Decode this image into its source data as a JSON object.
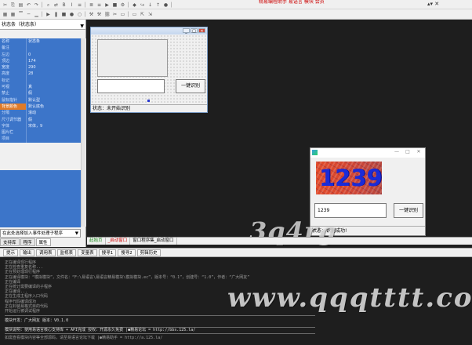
{
  "toolbar": {
    "top_icons": [
      "cut",
      "copy",
      "paste",
      "undo",
      "redo",
      "find",
      "replace",
      "bold",
      "italic",
      "align-left",
      "align-center",
      "align-right",
      "run",
      "stop",
      "compile",
      "debug",
      "step-over",
      "step-into",
      "step-out",
      "breakpoint"
    ],
    "row2_icons": [
      "grid",
      "grid-2",
      "align-top",
      "align-mid",
      "align-bottom",
      "play",
      "pause",
      "stop",
      "rec",
      "rec-2",
      "build",
      "build-2",
      "link",
      "unlink",
      "monitor",
      "monitor-2",
      "ext",
      "ext-2"
    ],
    "red_text": "精易编程助手  易语言  模块  会员",
    "ctrl_buttons": "▴▾ ✕"
  },
  "left_panel": {
    "object_selector": "状态条（状态条）",
    "properties": [
      {
        "key": "名称",
        "value": "状态条"
      },
      {
        "key": "备注",
        "value": ""
      },
      {
        "key": "左边",
        "value": "0"
      },
      {
        "key": "顶边",
        "value": "174"
      },
      {
        "key": "宽度",
        "value": "290"
      },
      {
        "key": "高度",
        "value": "28"
      },
      {
        "key": "标记",
        "value": ""
      },
      {
        "key": "可视",
        "value": "真"
      },
      {
        "key": "禁止",
        "value": "假"
      },
      {
        "key": "鼠标指针",
        "value": "默认型"
      },
      {
        "key": "背景颜色",
        "value": "默认底色",
        "highlight": true
      },
      {
        "key": "分隔",
        "value": "滚动"
      },
      {
        "key": "尺寸调节器",
        "value": "假"
      },
      {
        "key": "字体",
        "value": "宋体，9"
      },
      {
        "key": "图片栏",
        "value": ""
      },
      {
        "key": "项目",
        "value": ""
      }
    ],
    "event_selector": "在此处选择加入事件处理子程序",
    "tabs": [
      "支持库",
      "程序",
      "属性"
    ]
  },
  "design_window": {
    "min": "_",
    "max": "□",
    "close": "✕",
    "button_label": "一键识别",
    "status_text": "状态：未开始识别"
  },
  "run_window": {
    "min": "—",
    "max": "□",
    "close": "✕",
    "captcha_text": "1239",
    "input_value": "1239",
    "button_label": "一键识别",
    "status_text": "状态：识别成功!"
  },
  "file_tabs": [
    {
      "label": "起始页",
      "style": "green"
    },
    {
      "label": "_启动窗口",
      "style": "red"
    },
    {
      "label": "窗口程序集_启动窗口",
      "style": "normal"
    }
  ],
  "output_tabs": [
    "提示",
    "输出",
    "调用表",
    "监视表",
    "变量表",
    "搜寻1",
    "搜寻2",
    "剪辑历史"
  ],
  "output": {
    "lines": [
      "正在编译现行程序",
      "正在检查重复名称...",
      "正在预处理现行程序",
      "正在编译模块：“模拟模块”，文件名：“F:\\易语言\\易语言精易模块\\模拟模块.ec”，版本号：“0.1”，创建号：“1.0”，作者：“广大网友”",
      "正在编译",
      "正在统计需要编译的子程序",
      "正在编译...",
      "正在生成主程序入口代码",
      "程序代码编译成功",
      "正在封装易格式目的代码",
      "开始运行被调试程序"
    ],
    "info_lines": [
      {
        "text": "模块开发：广大网友      版本：V0.1.0",
        "bright": true
      },
      {
        "text": "模块说明：使用易语言核心支持库 + API完成        授权：开源永久免费   |●精易论坛      = http://bbs.125.la/",
        "bright": true
      },
      {
        "text": "如需查看模块内容等全部源码，请至易语言论坛下载      |●精易助手      = http://a.125.la/",
        "bright": false
      }
    ]
  },
  "watermark": {
    "top": "3q4rg",
    "bottom": "www.qqqtttt.com"
  }
}
